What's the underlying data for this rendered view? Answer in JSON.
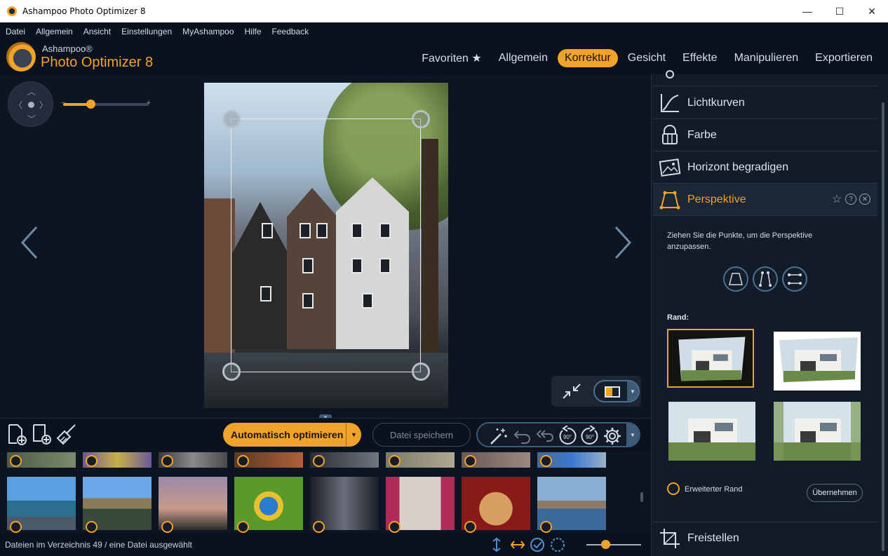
{
  "window": {
    "title": "Ashampoo Photo Optimizer 8",
    "minimize_glyph": "—",
    "maximize_glyph": "☐",
    "close_glyph": "✕"
  },
  "menu": [
    "Datei",
    "Allgemein",
    "Ansicht",
    "Einstellungen",
    "MyAshampoo",
    "Hilfe",
    "Feedback"
  ],
  "logo": {
    "brand": "Ashampoo®",
    "product": "Photo Optimizer 8"
  },
  "nav": {
    "tabs": [
      "Favoriten ★",
      "Allgemein",
      "Korrektur",
      "Gesicht",
      "Effekte",
      "Manipulieren",
      "Exportieren"
    ],
    "active": "Korrektur"
  },
  "viewer": {
    "zoom_minus": "−",
    "zoom_plus": "+",
    "zoom_level": 0.32
  },
  "toolbar": {
    "auto_optimize": "Automatisch optimieren",
    "save_file": "Datei speichern",
    "rotate_left_label": "90°",
    "rotate_right_label": "90°"
  },
  "status": {
    "text": "Dateien im Verzeichnis 49 / eine Datei ausgewählt",
    "thumb_size_level": 0.35
  },
  "panel": {
    "items": [
      {
        "label": "Lichtkurven",
        "icon": "curve-icon"
      },
      {
        "label": "Farbe",
        "icon": "palette-icon"
      },
      {
        "label": "Horizont begradigen",
        "icon": "horizon-icon"
      },
      {
        "label": "Perspektive",
        "icon": "perspective-icon"
      }
    ],
    "active_description": "Ziehen Sie die Punkte, um die Perspektive anzupassen.",
    "rand_label": "Rand:",
    "extended_border": "Erweiterter Rand",
    "apply": "Übernehmen",
    "bottom_item": "Freistellen",
    "help_glyph": "?",
    "close_glyph": "✕",
    "favorite_glyph": "☆"
  },
  "colors": {
    "accent": "#f0a32a",
    "background": "#0d1522",
    "panel": "#121b28"
  }
}
